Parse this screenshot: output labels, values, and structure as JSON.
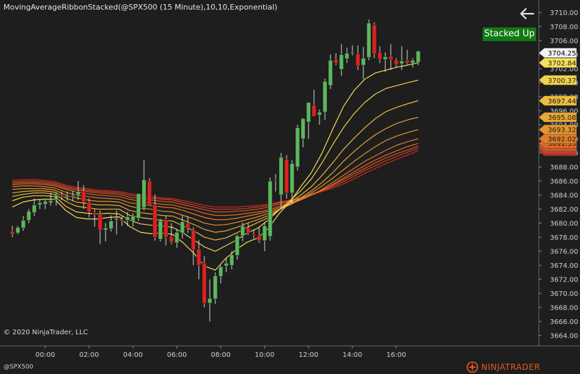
{
  "title": "MovingAverageRibbonStacked(@SPX500 (15 Minute),10,10,Exponential)",
  "copyright": "© 2020 NinjaTrader, LLC",
  "instrument": "@SPX500",
  "signal_label": "Stacked Up",
  "logo": {
    "prefix": "NINJA",
    "suffix": "TRADER"
  },
  "icons": {
    "back": "arrow-left-icon",
    "logo": "ninjatrader-logo-icon"
  },
  "colors": {
    "background": "#1e1e1e",
    "up": "#5cb85c",
    "down": "#e02020",
    "signal_bg": "#0f7a12",
    "axis_text": "#d0d0d0"
  },
  "chart_data": {
    "type": "candlestick",
    "title": "MovingAverageRibbonStacked(@SPX500 (15 Minute),10,10,Exponential)",
    "ylim": [
      3663,
      3711
    ],
    "y_ticks": [
      "3664.00",
      "3666.00",
      "3668.00",
      "3670.00",
      "3672.00",
      "3674.00",
      "3676.00",
      "3678.00",
      "3680.00",
      "3682.00",
      "3684.00",
      "3686.00",
      "3688.00",
      "3690.00",
      "3692.00",
      "3694.00",
      "3696.00",
      "3698.00",
      "3700.00",
      "3702.00",
      "3704.00",
      "3706.00",
      "3708.00",
      "3710.00"
    ],
    "x_ticks": [
      {
        "label": "00:00",
        "bar": 6
      },
      {
        "label": "02:00",
        "bar": 14
      },
      {
        "label": "04:00",
        "bar": 22
      },
      {
        "label": "06:00",
        "bar": 30
      },
      {
        "label": "08:00",
        "bar": 38
      },
      {
        "label": "10:00",
        "bar": 46
      },
      {
        "label": "12:00",
        "bar": 54
      },
      {
        "label": "14:00",
        "bar": 62
      },
      {
        "label": "16:00",
        "bar": 70
      }
    ],
    "grid": false,
    "candles": [
      [
        3678.8,
        3679.6,
        3678.0,
        3678.4
      ],
      [
        3678.6,
        3679.6,
        3678.4,
        3679.4
      ],
      [
        3679.3,
        3681.0,
        3678.9,
        3680.4
      ],
      [
        3680.4,
        3682.0,
        3680.0,
        3681.7
      ],
      [
        3681.5,
        3683.5,
        3681.0,
        3682.6
      ],
      [
        3682.6,
        3683.4,
        3682.0,
        3682.9
      ],
      [
        3682.7,
        3683.3,
        3682.0,
        3683.1
      ],
      [
        3682.9,
        3684.3,
        3682.5,
        3683.2
      ],
      [
        3683.3,
        3684.4,
        3682.5,
        3684.0
      ],
      [
        3684.0,
        3684.5,
        3683.3,
        3683.8
      ],
      [
        3683.7,
        3684.5,
        3683.2,
        3683.9
      ],
      [
        3683.8,
        3684.6,
        3683.1,
        3683.9
      ],
      [
        3684.0,
        3686.0,
        3683.3,
        3684.5
      ],
      [
        3684.5,
        3685.4,
        3682.0,
        3683.0
      ],
      [
        3683.0,
        3683.5,
        3680.8,
        3681.6
      ],
      [
        3681.5,
        3682.0,
        3679.5,
        3681.2
      ],
      [
        3681.3,
        3681.8,
        3677.0,
        3679.0
      ],
      [
        3679.0,
        3680.0,
        3677.4,
        3679.3
      ],
      [
        3679.2,
        3681.1,
        3678.8,
        3680.3
      ],
      [
        3680.5,
        3681.8,
        3678.4,
        3680.7
      ],
      [
        3680.5,
        3681.0,
        3679.6,
        3680.3
      ],
      [
        3680.4,
        3681.6,
        3679.6,
        3680.9
      ],
      [
        3680.3,
        3681.4,
        3679.5,
        3681.0
      ],
      [
        3680.7,
        3683.8,
        3680.3,
        3684.2
      ],
      [
        3682.2,
        3689.0,
        3681.8,
        3686.2
      ],
      [
        3686.0,
        3686.4,
        3682.6,
        3682.6
      ],
      [
        3682.6,
        3684.1,
        3677.5,
        3678.0
      ],
      [
        3677.7,
        3680.6,
        3677.4,
        3680.3
      ],
      [
        3680.5,
        3681.0,
        3676.8,
        3678.0
      ],
      [
        3678.1,
        3680.0,
        3677.0,
        3677.3
      ],
      [
        3677.2,
        3679.2,
        3676.5,
        3678.7
      ],
      [
        3678.6,
        3681.1,
        3677.8,
        3680.2
      ],
      [
        3680.0,
        3681.0,
        3678.6,
        3679.3
      ],
      [
        3679.0,
        3679.4,
        3674.0,
        3676.2
      ],
      [
        3676.3,
        3677.6,
        3672.0,
        3674.0
      ],
      [
        3674.3,
        3675.3,
        3668.0,
        3668.6
      ],
      [
        3668.6,
        3672.0,
        3666.0,
        3669.3
      ],
      [
        3669.2,
        3673.0,
        3668.5,
        3672.5
      ],
      [
        3672.4,
        3674.0,
        3671.4,
        3673.8
      ],
      [
        3673.9,
        3675.0,
        3673.0,
        3674.3
      ],
      [
        3674.0,
        3676.0,
        3673.4,
        3675.5
      ],
      [
        3675.4,
        3678.4,
        3674.8,
        3678.2
      ],
      [
        3678.2,
        3680.1,
        3677.4,
        3679.6
      ],
      [
        3679.3,
        3680.0,
        3678.3,
        3678.6
      ],
      [
        3678.5,
        3679.1,
        3677.8,
        3678.3
      ],
      [
        3678.2,
        3679.4,
        3677.2,
        3677.5
      ],
      [
        3677.5,
        3680.1,
        3676.0,
        3679.6
      ],
      [
        3678.1,
        3686.5,
        3677.5,
        3686.0
      ],
      [
        3686.2,
        3687.0,
        3684.5,
        3686.1
      ],
      [
        3684.0,
        3690.0,
        3682.0,
        3689.4
      ],
      [
        3689.1,
        3689.7,
        3683.5,
        3684.3
      ],
      [
        3684.3,
        3689.0,
        3682.7,
        3688.5
      ],
      [
        3688.0,
        3694.0,
        3687.5,
        3693.6
      ],
      [
        3692.0,
        3695.0,
        3690.8,
        3694.9
      ],
      [
        3694.4,
        3697.0,
        3692.0,
        3697.2
      ],
      [
        3696.8,
        3699.0,
        3695.4,
        3695.2
      ],
      [
        3695.4,
        3696.2,
        3694.0,
        3695.8
      ],
      [
        3695.8,
        3700.6,
        3694.7,
        3700.2
      ],
      [
        3699.6,
        3704.0,
        3699.1,
        3703.2
      ],
      [
        3703.3,
        3704.2,
        3702.5,
        3702.8
      ],
      [
        3701.9,
        3705.5,
        3701.0,
        3704.0
      ],
      [
        3703.4,
        3705.0,
        3702.8,
        3704.2
      ],
      [
        3704.3,
        3705.3,
        3703.9,
        3704.4
      ],
      [
        3704.1,
        3705.3,
        3701.8,
        3702.4
      ],
      [
        3702.5,
        3705.1,
        3700.5,
        3703.5
      ],
      [
        3703.6,
        3709.0,
        3703.2,
        3708.5
      ],
      [
        3708.2,
        3708.6,
        3703.5,
        3704.1
      ],
      [
        3704.3,
        3705.2,
        3702.8,
        3703.3
      ],
      [
        3703.3,
        3704.3,
        3701.5,
        3703.7
      ],
      [
        3703.8,
        3705.5,
        3701.8,
        3703.3
      ],
      [
        3703.2,
        3703.5,
        3702.2,
        3702.6
      ],
      [
        3702.7,
        3705.2,
        3701.8,
        3703.1
      ],
      [
        3703.2,
        3704.7,
        3702.6,
        3702.8
      ],
      [
        3702.8,
        3703.5,
        3702.2,
        3703.2
      ],
      [
        3702.9,
        3704.6,
        3702.5,
        3704.5
      ]
    ],
    "current_price": {
      "label": "3704.25",
      "value": 3704.25
    },
    "series": [
      {
        "color": "#f6e15a",
        "last_label": "3702.84",
        "last": 3702.84,
        "values": [
          3682.3,
          3683.0,
          3683.3,
          3683.4,
          3683.4,
          3681.8,
          3680.8,
          3680.6,
          3680.6,
          3680.8,
          3680.9,
          3679.5,
          3678.7,
          3678.5,
          3678.6,
          3678.4,
          3677.2,
          3675.7,
          3673.9,
          3673.3,
          3675.0,
          3676.3,
          3677.3,
          3677.9,
          3679.3,
          3681.4,
          3683.0,
          3685.2,
          3687.2,
          3690.0,
          3693.4,
          3696.6,
          3698.9,
          3700.5,
          3701.4,
          3701.8,
          3702.2,
          3702.5,
          3702.84
        ]
      },
      {
        "color": "#f2d44c",
        "last_label": "3700.37",
        "last": 3700.37,
        "values": [
          3683.2,
          3683.7,
          3683.9,
          3683.9,
          3683.8,
          3682.4,
          3681.6,
          3681.4,
          3681.3,
          3681.4,
          3681.3,
          3680.4,
          3679.9,
          3679.7,
          3679.6,
          3679.4,
          3678.6,
          3677.6,
          3676.6,
          3676.0,
          3676.8,
          3677.6,
          3678.6,
          3679.3,
          3680.5,
          3681.9,
          3683.2,
          3684.6,
          3686.3,
          3688.6,
          3691.2,
          3693.6,
          3695.6,
          3697.2,
          3698.4,
          3699.2,
          3699.6,
          3700.0,
          3700.37
        ]
      },
      {
        "color": "#eebe3e",
        "last_label": "3697.44",
        "last": 3697.44,
        "values": [
          3683.8,
          3684.1,
          3684.3,
          3684.3,
          3684.1,
          3683.1,
          3682.4,
          3682.2,
          3682.0,
          3682.0,
          3682.0,
          3681.1,
          3680.8,
          3680.6,
          3680.4,
          3680.3,
          3679.6,
          3678.9,
          3678.0,
          3677.6,
          3677.9,
          3678.6,
          3679.4,
          3680.1,
          3680.8,
          3681.9,
          3682.9,
          3684.0,
          3685.2,
          3686.8,
          3688.6,
          3690.5,
          3692.1,
          3693.6,
          3694.9,
          3695.9,
          3696.5,
          3697.0,
          3697.44
        ]
      },
      {
        "color": "#eaa833",
        "last_label": "3695.08",
        "last": 3695.08,
        "values": [
          3684.3,
          3684.5,
          3684.6,
          3684.6,
          3684.4,
          3683.6,
          3683.0,
          3682.8,
          3682.6,
          3682.6,
          3682.5,
          3681.8,
          3681.5,
          3681.3,
          3681.1,
          3681.0,
          3680.4,
          3679.8,
          3679.1,
          3678.7,
          3678.9,
          3679.4,
          3680.0,
          3680.5,
          3681.1,
          3681.9,
          3682.7,
          3683.6,
          3684.6,
          3685.8,
          3687.2,
          3688.8,
          3690.2,
          3691.5,
          3692.6,
          3693.5,
          3694.2,
          3694.7,
          3695.08
        ]
      },
      {
        "color": "#e7942c",
        "last_label": "3693.32",
        "last": 3693.32,
        "values": [
          3684.8,
          3684.9,
          3684.9,
          3684.9,
          3684.7,
          3684.0,
          3683.6,
          3683.3,
          3683.1,
          3683.1,
          3683.0,
          3682.4,
          3682.1,
          3682.0,
          3681.7,
          3681.6,
          3681.1,
          3680.6,
          3680.0,
          3679.7,
          3679.8,
          3680.1,
          3680.5,
          3680.9,
          3681.4,
          3682.0,
          3682.6,
          3683.4,
          3684.3,
          3685.3,
          3686.4,
          3687.6,
          3688.8,
          3689.9,
          3690.9,
          3691.8,
          3692.4,
          3692.9,
          3693.32
        ]
      },
      {
        "color": "#e27e28",
        "last_label": "3692.02",
        "last": 3692.02,
        "values": [
          3685.2,
          3685.3,
          3685.3,
          3685.2,
          3685.0,
          3684.4,
          3684.0,
          3683.8,
          3683.6,
          3683.5,
          3683.4,
          3682.9,
          3682.7,
          3682.5,
          3682.3,
          3682.2,
          3681.8,
          3681.3,
          3680.8,
          3680.5,
          3680.5,
          3680.7,
          3681.0,
          3681.3,
          3681.7,
          3682.2,
          3682.7,
          3683.3,
          3684.0,
          3684.8,
          3685.8,
          3686.8,
          3687.8,
          3688.8,
          3689.6,
          3690.4,
          3691.1,
          3691.6,
          3692.02
        ]
      },
      {
        "color": "#de6a26",
        "last_label": "3691.35",
        "last": 3691.35,
        "values": [
          3685.5,
          3685.6,
          3685.6,
          3685.5,
          3685.3,
          3684.8,
          3684.4,
          3684.2,
          3684.0,
          3683.9,
          3683.8,
          3683.4,
          3683.1,
          3682.9,
          3682.7,
          3682.6,
          3682.2,
          3681.9,
          3681.4,
          3681.1,
          3681.1,
          3681.2,
          3681.4,
          3681.6,
          3681.9,
          3682.4,
          3682.9,
          3683.4,
          3684.0,
          3684.7,
          3685.5,
          3686.4,
          3687.3,
          3688.2,
          3689.0,
          3689.7,
          3690.3,
          3690.9,
          3691.35
        ]
      },
      {
        "color": "#d95524",
        "last_label": "3690.96",
        "last": 3690.96,
        "values": [
          3685.7,
          3685.8,
          3685.8,
          3685.7,
          3685.5,
          3685.0,
          3684.7,
          3684.5,
          3684.3,
          3684.2,
          3684.1,
          3683.7,
          3683.5,
          3683.3,
          3683.1,
          3683.0,
          3682.6,
          3682.3,
          3681.9,
          3681.6,
          3681.6,
          3681.7,
          3681.8,
          3682.0,
          3682.3,
          3682.7,
          3683.1,
          3683.6,
          3684.1,
          3684.7,
          3685.4,
          3686.2,
          3687.0,
          3687.8,
          3688.6,
          3689.3,
          3689.9,
          3690.4,
          3690.96
        ]
      },
      {
        "color": "#d44022",
        "last_label": "3690.65",
        "last": 3690.65,
        "values": [
          3685.9,
          3686.0,
          3686.0,
          3685.9,
          3685.7,
          3685.2,
          3684.9,
          3684.7,
          3684.5,
          3684.4,
          3684.3,
          3684.0,
          3683.8,
          3683.6,
          3683.4,
          3683.3,
          3682.9,
          3682.6,
          3682.2,
          3682.0,
          3682.0,
          3682.0,
          3682.1,
          3682.3,
          3682.5,
          3682.9,
          3683.2,
          3683.6,
          3684.1,
          3684.6,
          3685.2,
          3685.9,
          3686.7,
          3687.5,
          3688.2,
          3688.9,
          3689.5,
          3690.1,
          3690.65
        ]
      },
      {
        "color": "#cf2a20",
        "last_label": "3690.31",
        "last": 3690.31,
        "values": [
          3686.1,
          3686.2,
          3686.2,
          3686.1,
          3685.9,
          3685.4,
          3685.1,
          3684.9,
          3684.7,
          3684.6,
          3684.5,
          3684.2,
          3684.0,
          3683.8,
          3683.6,
          3683.5,
          3683.2,
          3682.9,
          3682.5,
          3682.3,
          3682.3,
          3682.3,
          3682.4,
          3682.5,
          3682.7,
          3683.0,
          3683.3,
          3683.6,
          3684.0,
          3684.5,
          3685.0,
          3685.6,
          3686.3,
          3687.1,
          3687.8,
          3688.5,
          3689.1,
          3689.7,
          3690.31
        ]
      }
    ]
  }
}
